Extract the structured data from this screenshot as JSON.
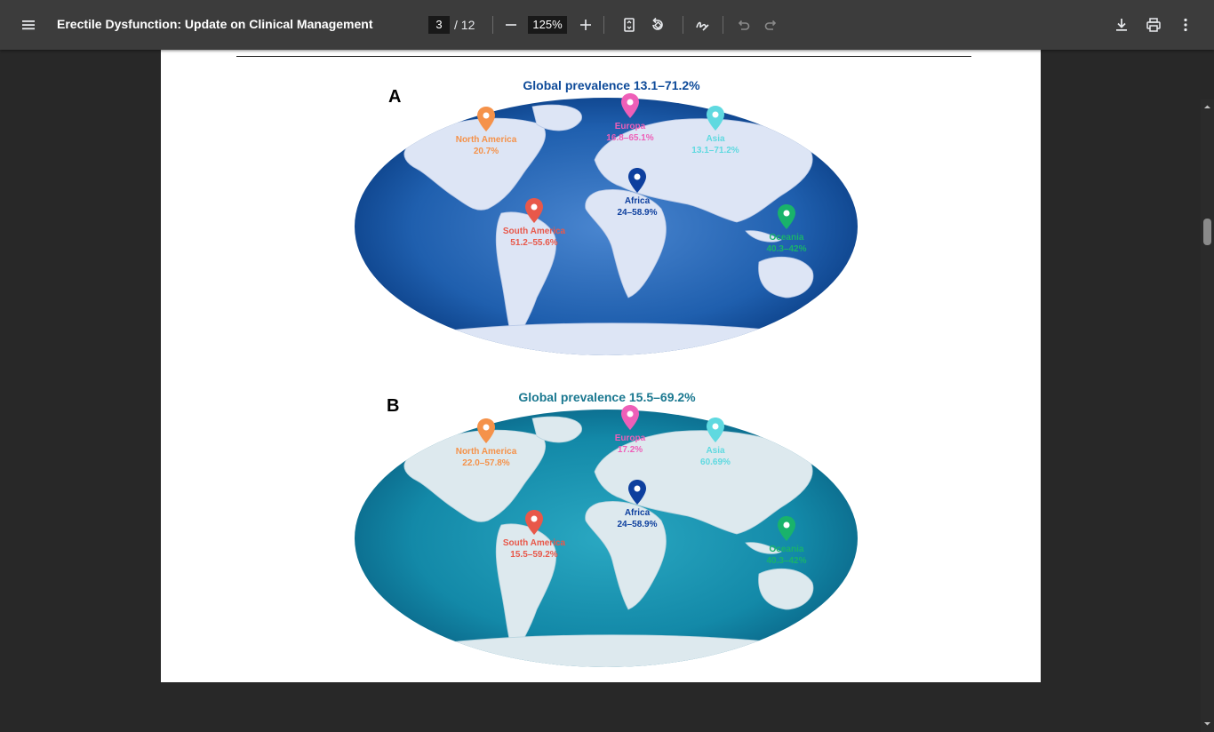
{
  "toolbar": {
    "menu_icon": "hamburger-menu-icon",
    "title": "Erectile Dysfunction: Update on Clinical Management",
    "page_current": "3",
    "page_total": "/ 12",
    "zoom": "125%",
    "icons": [
      "zoom-out-icon",
      "zoom-in-icon",
      "fit-page-icon",
      "rotate-icon",
      "annotate-icon",
      "undo-icon",
      "redo-icon",
      "download-icon",
      "print-icon",
      "more-options-icon"
    ]
  },
  "figure": {
    "panel_a": {
      "letter": "A",
      "title": "Global prevalence 13.1–71.2%",
      "title_color": "#0d4a99",
      "ocean_color": "#1f5fae",
      "regions": [
        {
          "name": "North America",
          "value": "20.7%",
          "color": "#f5924a"
        },
        {
          "name": "Europa",
          "value": "16.8–65.1%",
          "color": "#ee5fb8"
        },
        {
          "name": "Asia",
          "value": "13.1–71.2%",
          "color": "#5fd9e0"
        },
        {
          "name": "Africa",
          "value": "24–58.9%",
          "color": "#0d3f9e"
        },
        {
          "name": "South America",
          "value": "51.2–55.6%",
          "color": "#e8584a"
        },
        {
          "name": "Oceania",
          "value": "40.3–42%",
          "color": "#19b36b"
        }
      ]
    },
    "panel_b": {
      "letter": "B",
      "title": "Global prevalence 15.5–69.2%",
      "title_color": "#1a7890",
      "ocean_color": "#1389a8",
      "regions": [
        {
          "name": "North America",
          "value": "22.0–57.8%",
          "color": "#f5924a"
        },
        {
          "name": "Europa",
          "value": "17.2%",
          "color": "#ee5fb8"
        },
        {
          "name": "Asia",
          "value": "60.69%",
          "color": "#5fd9e0"
        },
        {
          "name": "Africa",
          "value": "24–58.9%",
          "color": "#0d3f9e"
        },
        {
          "name": "South America",
          "value": "15.5–59.2%",
          "color": "#e8584a"
        },
        {
          "name": "Oceania",
          "value": "40.3–42%",
          "color": "#19b36b"
        }
      ]
    }
  }
}
